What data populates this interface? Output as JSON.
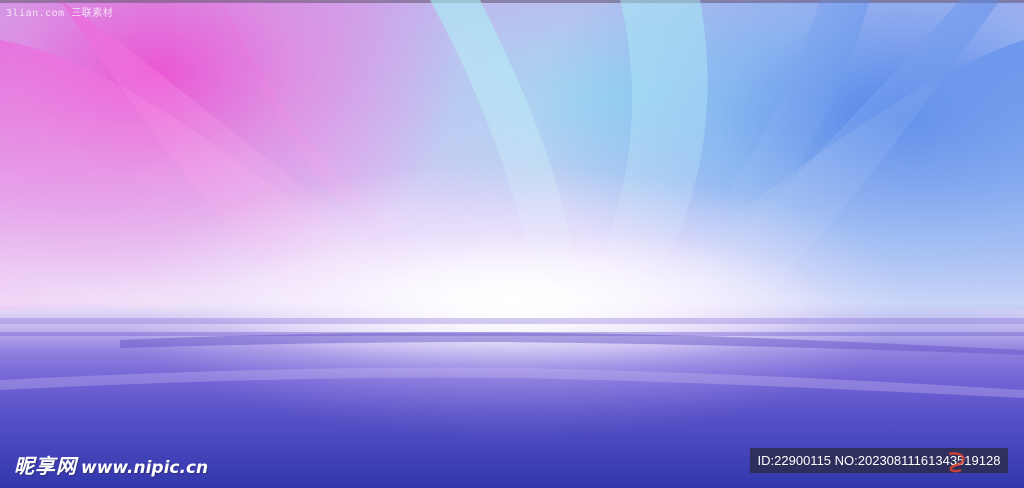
{
  "image": {
    "description_colors": {
      "pink": "#e650d2",
      "cyan": "#8ce6f0",
      "blue": "#3c78e6",
      "deep_blue": "#3a3fb8"
    }
  },
  "watermark_top": "3lian.com 三联素材",
  "nipic": {
    "brand": "昵享网",
    "url": "www.nipic.cn"
  },
  "id_badge": "ID:22900115 NO:20230811161343519128"
}
